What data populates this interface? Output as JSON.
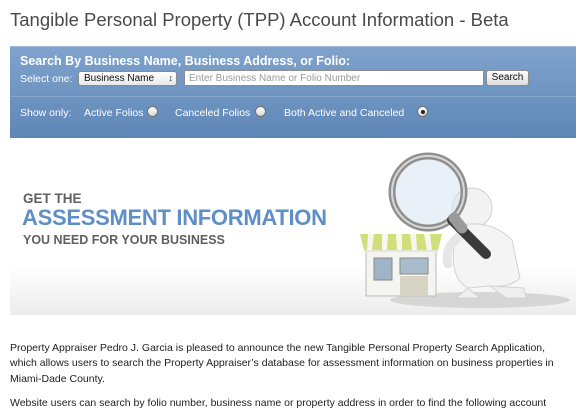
{
  "page": {
    "title": "Tangible Personal Property (TPP) Account Information - Beta"
  },
  "search": {
    "heading": "Search By Business Name, Business Address, or Folio:",
    "select_label": "Select one:",
    "select_value": "Business Name",
    "input_placeholder": "Enter Business Name or Folio Number",
    "input_value": "",
    "button_label": "Search"
  },
  "filters": {
    "label": "Show only:",
    "options": [
      {
        "label": "Active Folios",
        "checked": false
      },
      {
        "label": "Canceled Folios",
        "checked": false
      },
      {
        "label": "Both Active and Canceled",
        "checked": true
      }
    ]
  },
  "banner": {
    "line1": "GET THE",
    "line2": "ASSESSMENT INFORMATION",
    "line3": "YOU NEED FOR YOUR BUSINESS"
  },
  "content": {
    "para1": "Property Appraiser Pedro J. Garcia is pleased to announce the new Tangible Personal Property Search Application, which allows users to search the Property Appraiser’s database for assessment information on business properties in Miami-Dade County.",
    "para2": "Website users can search by folio number, business name or property address in order to find the following account"
  },
  "colors": {
    "panel_top": "#7fa3cc",
    "panel_bottom": "#5e86b6",
    "banner_accent": "#5f8fc6",
    "banner_gray": "#5f5f5f"
  },
  "icons": {
    "chevron": "chevron-up-down-icon",
    "magnifier": "magnifying-glass-icon",
    "storefront": "storefront-icon"
  }
}
